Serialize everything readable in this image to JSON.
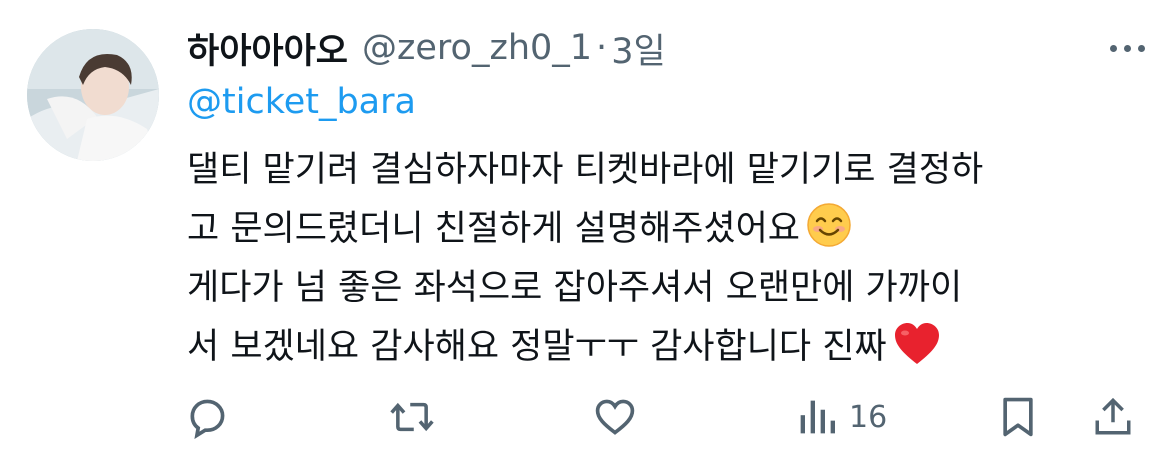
{
  "tweet": {
    "display_name": "하아아아오",
    "handle": "@zero_zh0_1",
    "separator": "·",
    "time": "3일",
    "mention": "@ticket_bara",
    "lines": [
      "댈티 맡기려 결심하자마자 티켓바라에 맡기기로 결정하",
      "고 문의드렸더니 친절하게 설명해주셨어요",
      "게다가 넘 좋은 좌석으로 잡아주셔서 오랜만에 가까이",
      "서 보겠네요 감사해요 정말ㅜㅜ 감사합니다 진짜"
    ],
    "emoji_1": "smiling-face-emoji",
    "emoji_2": "red-heart-emoji"
  },
  "actions": {
    "reply_icon": "reply-icon",
    "retweet_icon": "retweet-icon",
    "like_icon": "like-heart-icon",
    "views_icon": "views-chart-icon",
    "views_count": "16",
    "bookmark_icon": "bookmark-icon",
    "share_icon": "share-icon"
  },
  "colors": {
    "text": "#0f1419",
    "secondary": "#536471",
    "link": "#1d9bf0",
    "heart": "#e0245e"
  }
}
